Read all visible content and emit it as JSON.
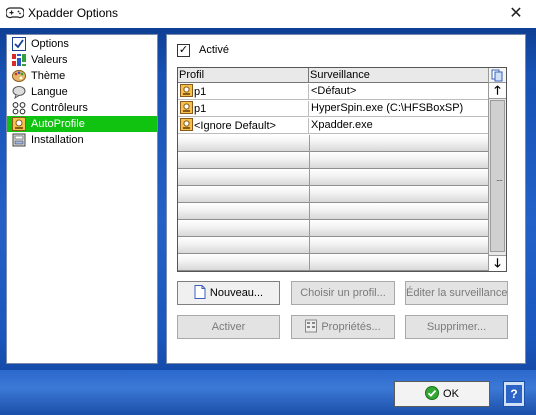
{
  "window": {
    "title": "Xpadder Options",
    "close_glyph": "✕",
    "icon": "gamepad-icon"
  },
  "sidebar": {
    "items": [
      {
        "label": "Options",
        "icon": "checkbox-icon",
        "active": false
      },
      {
        "label": "Valeurs",
        "icon": "values-icon",
        "active": false
      },
      {
        "label": "Thème",
        "icon": "palette-icon",
        "active": false
      },
      {
        "label": "Langue",
        "icon": "language-icon",
        "active": false
      },
      {
        "label": "Contrôleurs",
        "icon": "controllers-icon",
        "active": false
      },
      {
        "label": "AutoProfile",
        "icon": "autoprofile-icon",
        "active": true
      },
      {
        "label": "Installation",
        "icon": "installation-icon",
        "active": false
      }
    ],
    "active_color": "#11c311"
  },
  "autoprofile": {
    "active_checkbox": {
      "label": "Activé",
      "checked": true,
      "glyph": "✓"
    },
    "table": {
      "columns": [
        "Profil",
        "Surveillance"
      ],
      "rows": [
        {
          "profile": "p1",
          "watch": "<Défaut>",
          "icon": "profile-icon"
        },
        {
          "profile": "p1",
          "watch": "HyperSpin.exe (C:\\HFSBoxSP)",
          "icon": "profile-icon"
        },
        {
          "profile": "<Ignore Default>",
          "watch": "Xpadder.exe",
          "icon": "profile-icon"
        }
      ],
      "empty_rows": 8,
      "scroll_up_glyph": "🡑",
      "scroll_down_glyph": "🡓",
      "grip_glyph": "....",
      "corner_icon": "copy-icon"
    },
    "buttons": {
      "new": {
        "label": "Nouveau...",
        "enabled": true,
        "icon": "new-document-icon"
      },
      "choose_profile": {
        "label": "Choisir un profil...",
        "enabled": false
      },
      "edit_watch": {
        "label": "Éditer la surveillance",
        "enabled": false
      },
      "activate": {
        "label": "Activer",
        "enabled": false
      },
      "properties": {
        "label": "Propriétés...",
        "enabled": false,
        "icon": "properties-icon"
      },
      "delete": {
        "label": "Supprimer...",
        "enabled": false
      }
    }
  },
  "footer": {
    "ok_label": "OK",
    "ok_icon": "checkmark-icon",
    "help_glyph": "?",
    "help_icon": "help-icon"
  },
  "colors": {
    "frame": "#1752b5",
    "active_item": "#11c311",
    "disabled_text": "#7a7a7a"
  }
}
